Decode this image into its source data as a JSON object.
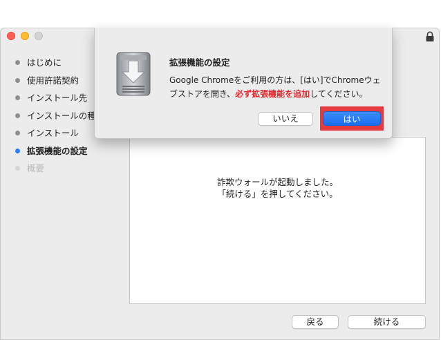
{
  "sidebar": {
    "steps": [
      {
        "label": "はじめに",
        "state": "done"
      },
      {
        "label": "使用許諾契約",
        "state": "done"
      },
      {
        "label": "インストール先",
        "state": "done"
      },
      {
        "label": "インストールの種類",
        "state": "done"
      },
      {
        "label": "インストール",
        "state": "done"
      },
      {
        "label": "拡張機能の設定",
        "state": "active"
      },
      {
        "label": "概要",
        "state": "pending"
      }
    ]
  },
  "content": {
    "line1": "詐欺ウォールが起動しました。",
    "line2": "「続ける」を押してください。"
  },
  "footer": {
    "back_label": "戻る",
    "continue_label": "続ける"
  },
  "dialog": {
    "title": "拡張機能の設定",
    "message_part1": "Google Chromeをご利用の方は、[はい]でChromeウェブストアを開き、",
    "message_emphasis": "必ず拡張機能を追加",
    "message_part2": "してください。",
    "no_label": "いいえ",
    "yes_label": "はい"
  },
  "colors": {
    "accent": "#2a7df5",
    "highlight": "#e53b3f",
    "emphasis_text": "#e5262b"
  }
}
